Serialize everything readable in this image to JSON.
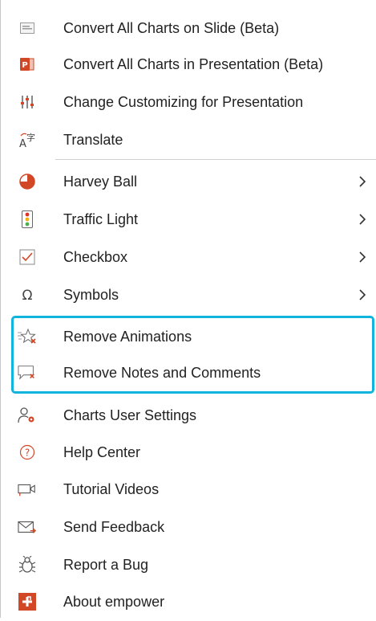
{
  "menu": {
    "items": [
      {
        "label": "Convert All Charts on Slide (Beta)",
        "icon": "chart-slide-icon"
      },
      {
        "label": "Convert All Charts in Presentation (Beta)",
        "icon": "powerpoint-icon"
      },
      {
        "label": "Change Customizing for Presentation",
        "icon": "sliders-icon"
      },
      {
        "label": "Translate",
        "icon": "translate-icon"
      },
      {
        "label": "Harvey Ball",
        "icon": "harvey-ball-icon",
        "submenu": true
      },
      {
        "label": "Traffic Light",
        "icon": "traffic-light-icon",
        "submenu": true
      },
      {
        "label": "Checkbox",
        "icon": "checkbox-icon",
        "submenu": true
      },
      {
        "label": "Symbols",
        "icon": "omega-icon",
        "submenu": true
      },
      {
        "label": "Remove Animations",
        "icon": "remove-animations-icon"
      },
      {
        "label": "Remove Notes and Comments",
        "icon": "remove-comments-icon"
      },
      {
        "label": "Charts User Settings",
        "icon": "user-settings-icon"
      },
      {
        "label": "Help Center",
        "icon": "help-icon"
      },
      {
        "label": "Tutorial Videos",
        "icon": "video-icon"
      },
      {
        "label": "Send Feedback",
        "icon": "mail-icon"
      },
      {
        "label": "Report a Bug",
        "icon": "bug-icon"
      },
      {
        "label": "About empower",
        "icon": "empower-logo-icon"
      }
    ]
  },
  "colors": {
    "highlight_border": "#10b4dc",
    "accent_red": "#d24726",
    "text": "#222222"
  }
}
